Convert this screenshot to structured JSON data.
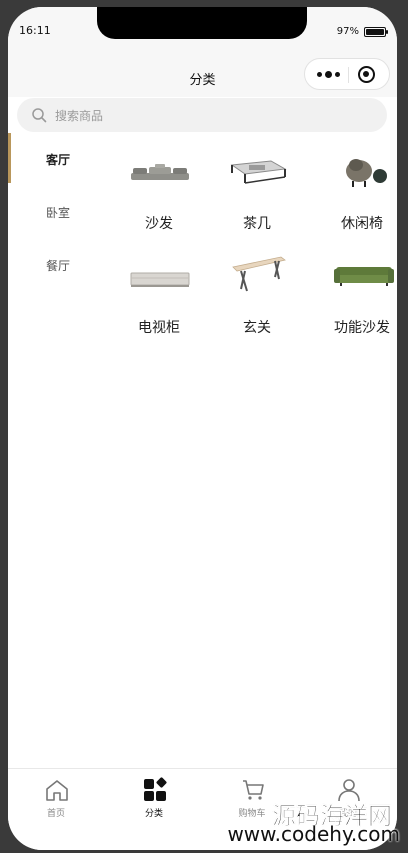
{
  "status": {
    "time": "16:11",
    "battery": "97%"
  },
  "nav": {
    "title": "分类"
  },
  "search": {
    "placeholder": "搜索商品"
  },
  "sidebar": {
    "items": [
      {
        "label": "客厅",
        "active": true
      },
      {
        "label": "卧室",
        "active": false
      },
      {
        "label": "餐厅",
        "active": false
      }
    ]
  },
  "products": [
    {
      "name": "沙发",
      "icon": "sofa-thumbnail"
    },
    {
      "name": "茶几",
      "icon": "coffee-table-thumbnail"
    },
    {
      "name": "休闲椅",
      "icon": "lounge-chair-thumbnail"
    },
    {
      "name": "电视柜",
      "icon": "tv-cabinet-thumbnail"
    },
    {
      "name": "玄关",
      "icon": "console-table-thumbnail"
    },
    {
      "name": "功能沙发",
      "icon": "green-sofa-thumbnail"
    }
  ],
  "tabbar": {
    "items": [
      {
        "label": "首页",
        "icon": "home-icon"
      },
      {
        "label": "分类",
        "icon": "category-icon",
        "active": true
      },
      {
        "label": "购物车",
        "icon": "cart-icon"
      },
      {
        "label": "我的",
        "icon": "user-icon"
      }
    ]
  },
  "watermark": {
    "line1": "源码海洋网",
    "line2": "www.codehy.com"
  },
  "colors": {
    "accent": "#b9975b",
    "background": "#ffffff",
    "bar": "#f7f7f7"
  }
}
